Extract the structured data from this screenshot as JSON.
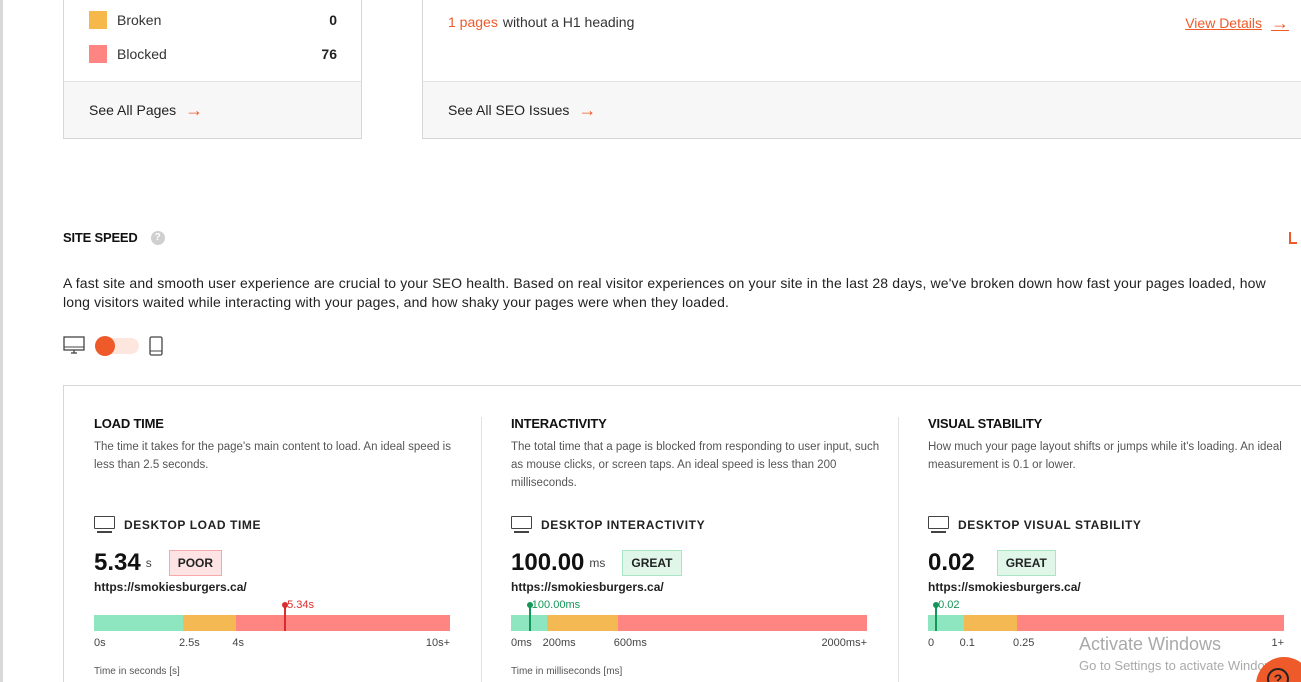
{
  "pages_card": {
    "legend": [
      {
        "label": "Broken",
        "value": "0",
        "color": "#f7b84b"
      },
      {
        "label": "Blocked",
        "value": "76",
        "color": "#fe8581"
      }
    ],
    "see_all_label": "See All Pages"
  },
  "seo_card": {
    "issue_count": "1 pages",
    "issue_text": "without a H1 heading",
    "view_details_label": "View Details",
    "see_all_label": "See All SEO Issues"
  },
  "site_speed": {
    "title": "SITE SPEED",
    "help_icon": "?",
    "intro": "A fast site and smooth user experience are crucial to your SEO health. Based on real visitor experiences on your site in the last 28 days, we've broken down how fast your pages loaded, how long visitors waited while interacting with your pages, and how shaky your pages were when they loaded.",
    "device_toggle": {
      "selected": "desktop"
    }
  },
  "metrics": [
    {
      "title": "LOAD TIME",
      "description": "The time it takes for the page's main content to load. An ideal speed is less than 2.5 seconds.",
      "subheading": "DESKTOP LOAD TIME",
      "value": "5.34",
      "unit": "s",
      "rating": "POOR",
      "url": "https://smokiesburgers.ca/",
      "marker_label": "5.34s",
      "marker_fraction": 0.534,
      "segments": [
        0.25,
        0.15,
        0.6
      ],
      "ticks": [
        {
          "label": "0s",
          "fraction": 0
        },
        {
          "label": "2.5s",
          "fraction": 0.25
        },
        {
          "label": "4s",
          "fraction": 0.4
        },
        {
          "label": "10s+",
          "fraction": 1
        }
      ],
      "axis_caption": "Time in seconds [s]"
    },
    {
      "title": "INTERACTIVITY",
      "description": "The total time that a page is blocked from responding to user input, such as mouse clicks, or screen taps. An ideal speed is less than 200 milliseconds.",
      "subheading": "DESKTOP INTERACTIVITY",
      "value": "100.00",
      "unit": "ms",
      "rating": "GREAT",
      "url": "https://smokiesburgers.ca/",
      "marker_label": "100.00ms",
      "marker_fraction": 0.05,
      "segments": [
        0.1,
        0.2,
        0.7
      ],
      "ticks": [
        {
          "label": "0ms",
          "fraction": 0
        },
        {
          "label": "200ms",
          "fraction": 0.1
        },
        {
          "label": "600ms",
          "fraction": 0.3
        },
        {
          "label": "2000ms+",
          "fraction": 1
        }
      ],
      "axis_caption": "Time in milliseconds [ms]"
    },
    {
      "title": "VISUAL STABILITY",
      "description": "How much your page layout shifts or jumps while it's loading. An ideal measurement is 0.1 or lower.",
      "subheading": "DESKTOP VISUAL STABILITY",
      "value": "0.02",
      "unit": "",
      "rating": "GREAT",
      "url": "https://smokiesburgers.ca/",
      "marker_label": "0.02",
      "marker_fraction": 0.02,
      "segments": [
        0.1,
        0.15,
        0.75
      ],
      "ticks": [
        {
          "label": "0",
          "fraction": 0
        },
        {
          "label": "0.1",
          "fraction": 0.1
        },
        {
          "label": "0.25",
          "fraction": 0.25
        },
        {
          "label": "1+",
          "fraction": 1
        }
      ],
      "axis_caption": ""
    }
  ],
  "colors": {
    "accent": "#ef5a2a",
    "good": "#8de6c0",
    "needs_improvement": "#f4b952",
    "poor": "#fe8581",
    "poor_marker": "#d92d2d",
    "great_marker": "#139657"
  },
  "watermark": {
    "line1": "Activate Windows",
    "line2": "Go to Settings to activate Windows."
  }
}
